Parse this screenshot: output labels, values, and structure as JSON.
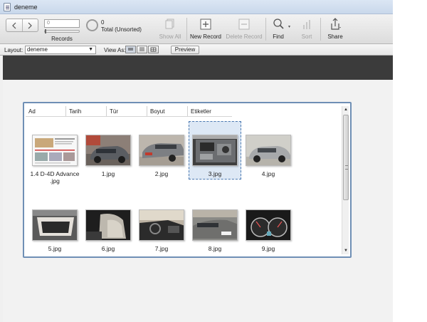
{
  "window": {
    "title": "deneme"
  },
  "toolbar": {
    "record_slider_value": "0",
    "records_label": "Records",
    "found_count": "0",
    "found_label": "Total (Unsorted)",
    "show_all": "Show All",
    "new_record": "New Record",
    "delete_record": "Delete Record",
    "find": "Find",
    "sort": "Sort",
    "share": "Share"
  },
  "layoutbar": {
    "layout_label": "Layout:",
    "layout_value": "deneme",
    "view_as_label": "View As:",
    "preview_label": "Preview"
  },
  "columns": [
    "Ad",
    "Tarih",
    "Tür",
    "Boyut",
    "Etiketler"
  ],
  "files": [
    {
      "name": "1.4 D-4D Advance .jpg",
      "thumb": "document"
    },
    {
      "name": "1.jpg",
      "thumb": "car-front-grey"
    },
    {
      "name": "2.jpg",
      "thumb": "car-rear"
    },
    {
      "name": "3.jpg",
      "thumb": "engine",
      "selected": true
    },
    {
      "name": "4.jpg",
      "thumb": "car-side"
    },
    {
      "name": "5.jpg",
      "thumb": "trunk"
    },
    {
      "name": "6.jpg",
      "thumb": "seat"
    },
    {
      "name": "7.jpg",
      "thumb": "interior"
    },
    {
      "name": "8.jpg",
      "thumb": "car-front-plate"
    },
    {
      "name": "9.jpg",
      "thumb": "dashboard"
    }
  ],
  "colors": {
    "selection": "#dde8f5",
    "container_border": "#6f8fb5",
    "dark_band": "#3b3b3b"
  }
}
